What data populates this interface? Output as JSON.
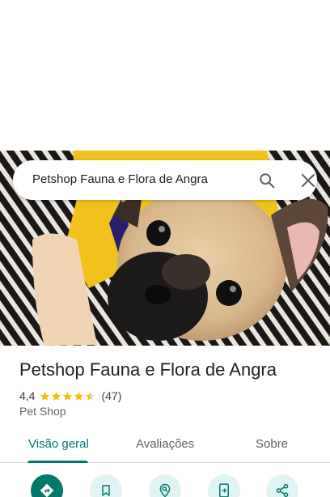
{
  "search": {
    "query": "Petshop Fauna e Flora de Angra",
    "search_icon": "search-icon",
    "close_icon": "close-icon"
  },
  "hero_photo": {
    "subject": "pug puppy in yellow shirt on striped rug"
  },
  "place": {
    "name": "Petshop Fauna e Flora de Angra",
    "rating": "4,4",
    "stars": 4.4,
    "review_count": "(47)",
    "category": "Pet Shop"
  },
  "tabs": [
    {
      "label": "Visão geral",
      "active": true
    },
    {
      "label": "Avaliações",
      "active": false
    },
    {
      "label": "Sobre",
      "active": false
    }
  ],
  "actions": [
    {
      "icon": "directions-icon"
    },
    {
      "icon": "save-bookmark-icon"
    },
    {
      "icon": "nearby-icon"
    },
    {
      "icon": "send-to-phone-icon"
    },
    {
      "icon": "share-icon"
    }
  ],
  "colors": {
    "accent": "#00796b",
    "action_bg": "#e0f4f3",
    "star": "#fbbc04",
    "text": "#202124",
    "muted": "#5f6368"
  }
}
